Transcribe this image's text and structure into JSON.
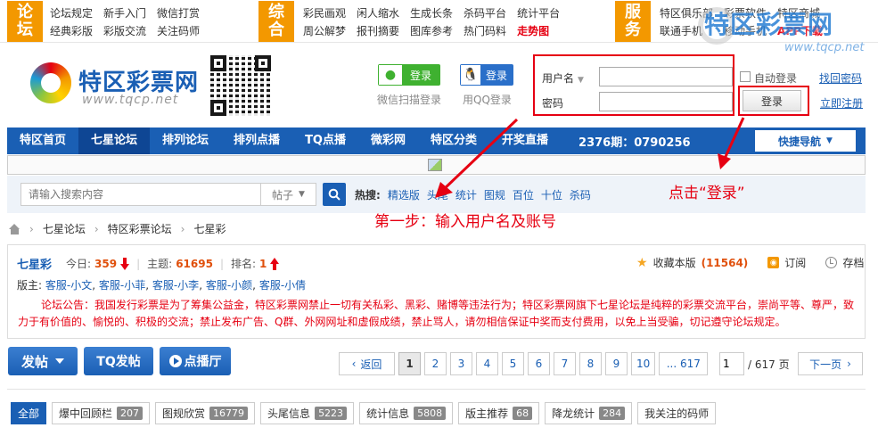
{
  "top_nav": {
    "group1": {
      "tag": [
        "论",
        "坛"
      ],
      "links": [
        "论坛规定",
        "经典彩版",
        "新手入门",
        "彩版交流",
        "微信打赏",
        "关注码师"
      ]
    },
    "group2": {
      "tag": [
        "综",
        "合"
      ],
      "links": [
        "彩民画观",
        "周公解梦",
        "闲人缩水",
        "报刊摘要",
        "生成长条",
        "图库参考",
        "杀码平台",
        "热门码料",
        "统计平台",
        "走势图"
      ],
      "highlight_link": "走势图"
    },
    "group3": {
      "tag": [
        "服",
        "务"
      ],
      "links": [
        "特区俱乐部",
        "联通手机",
        "彩票软件",
        "移动手机",
        "特区商城",
        "APP下载"
      ]
    },
    "watermark": "特区彩票网",
    "watermark_url": "www.tqcp.net"
  },
  "header": {
    "logo_text": "特区彩票网",
    "logo_url": "www.tqcp.net",
    "wechat": {
      "button": "登录",
      "caption": "微信扫描登录"
    },
    "qq": {
      "button": "登录",
      "caption": "用QQ登录"
    },
    "login": {
      "username_label": "用户名",
      "password_label": "密码",
      "username_value": "",
      "password_value": "",
      "auto_login": "自动登录",
      "find_password": "找回密码",
      "register": "立即注册",
      "submit": "登录"
    }
  },
  "main_nav": {
    "items": [
      "特区首页",
      "七星论坛",
      "排列论坛",
      "排列点播",
      "TQ点播",
      "微彩网",
      "特区分类",
      "开奖直播"
    ],
    "active_index": 1,
    "issue": "2376期：0790256",
    "quick_nav": "快捷导航"
  },
  "search": {
    "placeholder": "请输入搜索内容",
    "type": "帖子",
    "hot_label": "热搜:",
    "hot_links": [
      "精选版",
      "头尾",
      "统计",
      "图规",
      "百位",
      "十位",
      "杀码"
    ]
  },
  "annotations": {
    "step1": "第一步：输入用户名及账号",
    "step2": "点击“登录”"
  },
  "breadcrumb": [
    "七星论坛",
    "特区彩票论坛",
    "七星彩"
  ],
  "forum": {
    "title": "七星彩",
    "today_label": "今日:",
    "today": "359",
    "topics_label": "主题:",
    "topics": "61695",
    "rank_label": "排名:",
    "rank": "1",
    "favorite_label": "收藏本版",
    "favorite_count": "(11564)",
    "subscribe": "订阅",
    "archive": "存档",
    "moderators_label": "版主:",
    "moderators": [
      "客服-小文",
      "客服-小菲",
      "客服-小李",
      "客服-小颜",
      "客服-小倩"
    ],
    "notice": "论坛公告：我国发行彩票是为了筹集公益金，特区彩票网禁止一切有关私彩、黑彩、赌博等违法行为；特区彩票网旗下七星论坛是纯粹的彩票交流平台，崇尚平等、尊严，致力于有价值的、愉悦的、积极的交流；禁止发布广告、Q群、外网网址和虚假成绩，禁止骂人，请勿相信保证中奖而支付费用，以免上当受骗，切记遵守论坛规定。"
  },
  "actions": {
    "post": "发帖",
    "tq_post": "TQ发帖",
    "request": "点播厅"
  },
  "pager": {
    "back": "返回",
    "pages": [
      "1",
      "2",
      "3",
      "4",
      "5",
      "6",
      "7",
      "8",
      "9",
      "10"
    ],
    "current": "1",
    "ellipsis": "... 617",
    "input_value": "1",
    "total": "/ 617 页",
    "next": "下一页"
  },
  "tabs": [
    {
      "label": "全部",
      "badge": ""
    },
    {
      "label": "爆中回顾栏",
      "badge": "207"
    },
    {
      "label": "图规欣赏",
      "badge": "16779"
    },
    {
      "label": "头尾信息",
      "badge": "5223"
    },
    {
      "label": "统计信息",
      "badge": "5808"
    },
    {
      "label": "版主推荐",
      "badge": "68"
    },
    {
      "label": "降龙统计",
      "badge": "284"
    },
    {
      "label": "我关注的码师",
      "badge": ""
    }
  ],
  "colors": {
    "brand_blue": "#1a5fb4",
    "tag_orange": "#f39800",
    "annotation_red": "#e60012",
    "wechat_green": "#3fb130"
  }
}
